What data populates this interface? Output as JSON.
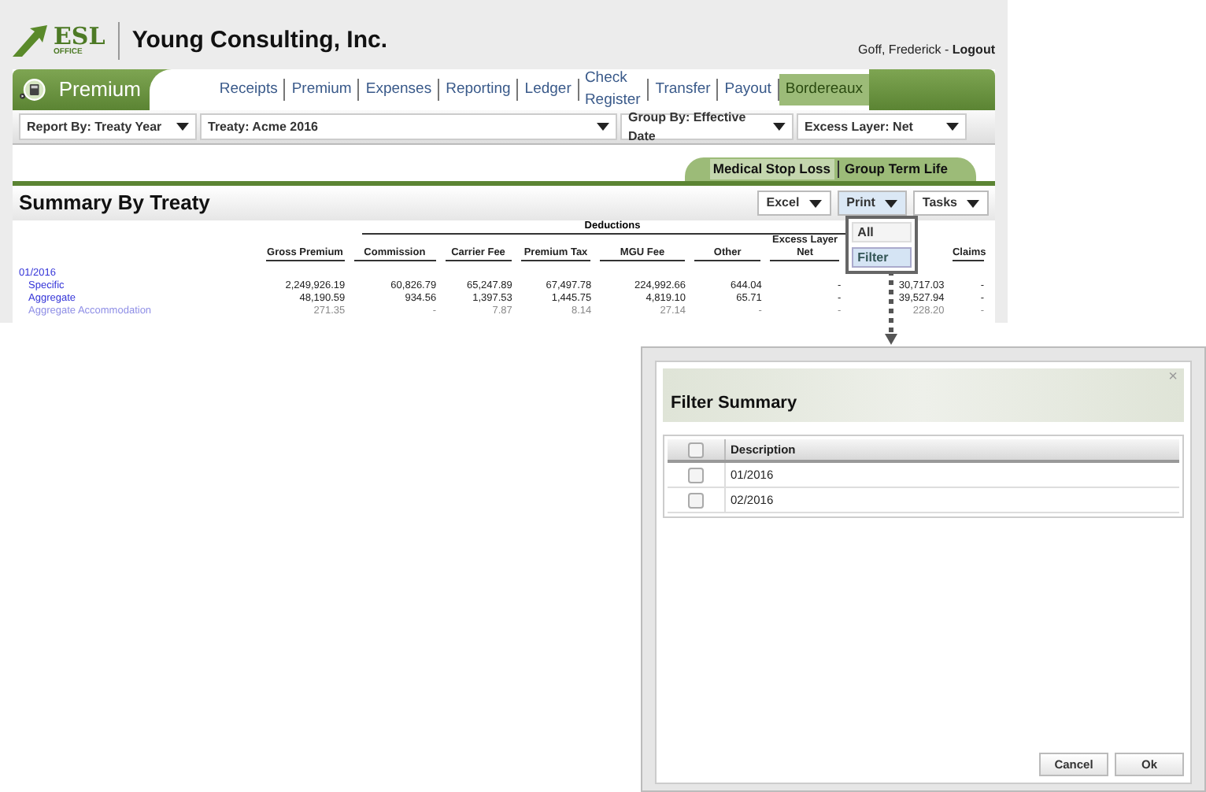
{
  "header": {
    "logo_top": "ESL",
    "logo_bottom": "OFFICE",
    "company": "Young Consulting, Inc.",
    "user": "Goff, Frederick - ",
    "logout": "Logout"
  },
  "nav": {
    "module": "Premium",
    "tabs": [
      {
        "label": "Receipts",
        "selected": false
      },
      {
        "label": "Premium",
        "selected": false
      },
      {
        "label": "Expenses",
        "selected": false
      },
      {
        "label": "Reporting",
        "selected": false
      },
      {
        "label": "Ledger",
        "selected": false
      },
      {
        "label": "Check Register",
        "selected": false
      },
      {
        "label": "Transfer",
        "selected": false
      },
      {
        "label": "Payout",
        "selected": false
      },
      {
        "label": "Bordereaux",
        "selected": true
      }
    ]
  },
  "filters": [
    {
      "label": "Report By: Treaty Year"
    },
    {
      "label": "Treaty: Acme 2016"
    },
    {
      "label": "Group By: Effective Date"
    },
    {
      "label": "Excess Layer: Net"
    }
  ],
  "subtabs": [
    {
      "label": "Medical Stop Loss",
      "selected": true
    },
    {
      "label": "Group Term Life",
      "selected": false
    }
  ],
  "summary": {
    "title": "Summary By Treaty",
    "buttons": [
      {
        "label": "Excel"
      },
      {
        "label": "Print"
      },
      {
        "label": "Tasks"
      }
    ],
    "print_menu": [
      {
        "label": "All",
        "selected": false
      },
      {
        "label": "Filter",
        "selected": true
      }
    ],
    "deductions_label": "Deductions",
    "columns": [
      "Gross Premium",
      "Commission",
      "Carrier Fee",
      "Premium Tax",
      "MGU Fee",
      "Other",
      "Excess Layer Net",
      "",
      "Claims"
    ],
    "rows": [
      {
        "kind": "group",
        "label": "01/2016",
        "values": []
      },
      {
        "kind": "item",
        "label": "Specific",
        "values": [
          "2,249,926.19",
          "60,826.79",
          "65,247.89",
          "67,497.78",
          "224,992.66",
          "644.04",
          "-",
          "30,717.03",
          "-"
        ]
      },
      {
        "kind": "item",
        "label": "Aggregate",
        "values": [
          "48,190.59",
          "934.56",
          "1,397.53",
          "1,445.75",
          "4,819.10",
          "65.71",
          "-",
          "39,527.94",
          "-"
        ]
      },
      {
        "kind": "item",
        "label": "Aggregate Accommodation",
        "values": [
          "271.35",
          "-",
          "7.87",
          "8.14",
          "27.14",
          "-",
          "-",
          "228.20",
          "-"
        ]
      }
    ]
  },
  "dialog": {
    "title": "Filter Summary",
    "close": "×",
    "column": "Description",
    "all_checked": false,
    "rows": [
      {
        "label": "01/2016",
        "checked": false
      },
      {
        "label": "02/2016",
        "checked": false
      }
    ],
    "buttons": [
      {
        "label": "Cancel"
      },
      {
        "label": "Ok"
      }
    ]
  }
}
